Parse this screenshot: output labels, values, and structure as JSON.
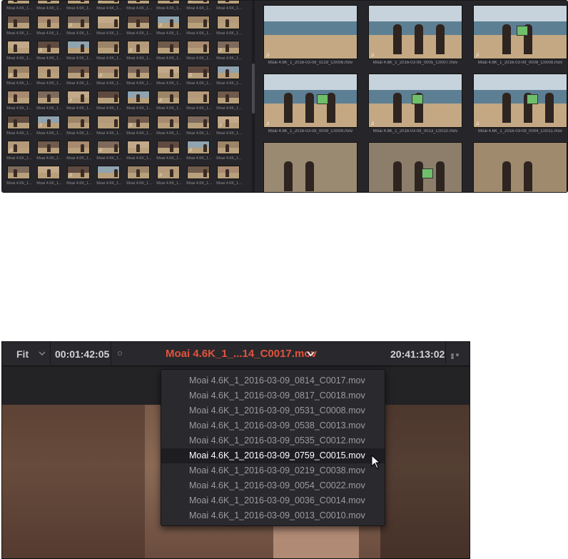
{
  "media_pool": {
    "small_clip_labels": [
      "Moai 4.6K_1...",
      "Moai 4.6K_1...",
      "Moai 4.6K_1...",
      "Moai 4.6K_1...",
      "Moai 4.6K_1...",
      "Moai 4.6K_1...",
      "Moai 4.6K_1...",
      "Moai 4.6K_1..."
    ],
    "large_clips": [
      {
        "label": "Moai 4.6K_1_2016-03-09_0219_C0006.mov"
      },
      {
        "label": "Moai 4.6K_1_2016-03-09_0005_C0007.mov"
      },
      {
        "label": "Moai 4.6K_1_2016-03-09_0008_C0008.mov"
      },
      {
        "label": "Moai 4.6K_1_2016-03-09_0009_C0009.mov"
      },
      {
        "label": "Moai 4.6K_1_2016-03-09_0013_C0010.mov"
      },
      {
        "label": "Moai 4.6K_1_2016-03-09_0004_C0011.mov"
      },
      {
        "label": ""
      },
      {
        "label": ""
      },
      {
        "label": ""
      }
    ]
  },
  "viewer": {
    "zoom": "Fit",
    "source_timecode": "00:01:42:05",
    "clip_name": "Moai 4.6K_1_...14_C0017.mov",
    "record_timecode": "20:41:13:02"
  },
  "clip_dropdown": {
    "items": [
      "Moai 4.6K_1_2016-03-09_0814_C0017.mov",
      "Moai 4.6K_1_2016-03-09_0817_C0018.mov",
      "Moai 4.6K_1_2016-03-09_0531_C0008.mov",
      "Moai 4.6K_1_2016-03-09_0538_C0013.mov",
      "Moai 4.6K_1_2016-03-09_0535_C0012.mov",
      "Moai 4.6K_1_2016-03-09_0759_C0015.mov",
      "Moai 4.6K_1_2016-03-09_0219_C0038.mov",
      "Moai 4.6K_1_2016-03-09_0054_C0022.mov",
      "Moai 4.6K_1_2016-03-09_0036_C0014.mov",
      "Moai 4.6K_1_2016-03-09_0013_C0010.mov"
    ],
    "highlighted_index": 5
  },
  "colors": {
    "clip_name": "#e0533e",
    "panel": "#26262a",
    "dropdown": "#2a2a2e"
  }
}
